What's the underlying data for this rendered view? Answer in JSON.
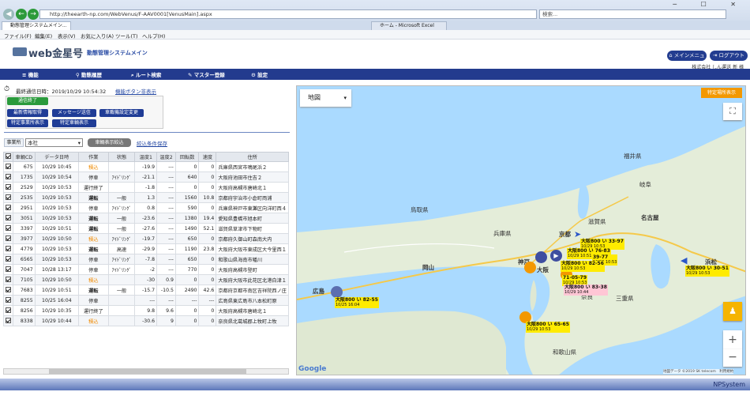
{
  "browser": {
    "address": "http://theearth-np.com/WebVenus/F-AAV0001[VenusMain].aspx",
    "search_placeholder": "検索...",
    "tab1": "動態管理システムメイン...",
    "tab2": "ホーム - Microsoft Excel"
  },
  "menu": [
    "ファイル(F)",
    "編集(E)",
    "表示(V)",
    "お気に入り(A)",
    "ツール(T)",
    "ヘルプ(H)"
  ],
  "header": {
    "logo": "web金星号",
    "subtitle": "動態管理システムメイン",
    "main_menu": "メインメニュー",
    "logout": "ログアウト",
    "company": "株式会社 しん運送 新 様"
  },
  "nav": [
    "機能",
    "動態履歴",
    "ルート検索",
    "マスター登録",
    "設定"
  ],
  "status": {
    "last_update": "最終通信日時：2019/10/29 10:54:32",
    "hide_buttons": "機能ボタン非表示"
  },
  "buttons": {
    "end_comm": "通信終了",
    "latest": "最新情報取得",
    "message": "メッセージ送信",
    "car_settings": "車載機設定変更",
    "spec_office": "特定事業所表示",
    "spec_vehicle": "特定車輌表示"
  },
  "filter": {
    "office_label": "事業所",
    "office_value": "本社",
    "filter_btn": "車輌表示絞込",
    "save": "絞込条件保存"
  },
  "table": {
    "headers": [
      "",
      "車輌CD",
      "データ日時",
      "作業",
      "状態",
      "温度1",
      "温度2",
      "回転数",
      "速度",
      "住所"
    ],
    "rows": [
      [
        "675",
        "10/29 10:45",
        "積込",
        "",
        "-19.9",
        "---",
        "0",
        "0",
        "兵庫県西宮市鳴尾浜２"
      ],
      [
        "1735",
        "10/29 10:54",
        "停車",
        "ｱｲﾄﾞﾘﾝｸﾞ",
        "-21.1",
        "---",
        "640",
        "0",
        "大阪府池田市住吉２"
      ],
      [
        "2529",
        "10/29 10:53",
        "運行終了",
        "",
        "-1.8",
        "---",
        "0",
        "0",
        "大阪府高槻市唐崎北１"
      ],
      [
        "2535",
        "10/29 10:53",
        "運転",
        "一般",
        "1.3",
        "---",
        "1560",
        "10.8",
        "京都府宇治市小倉町両浦"
      ],
      [
        "2951",
        "10/29 10:53",
        "停車",
        "ｱｲﾄﾞﾘﾝｸﾞ",
        "0.8",
        "---",
        "590",
        "0",
        "兵庫県神戸市東灘区向洋町西４"
      ],
      [
        "3051",
        "10/29 10:53",
        "運転",
        "一般",
        "-23.6",
        "---",
        "1380",
        "19.4",
        "愛知県豊橋市旭本町"
      ],
      [
        "3397",
        "10/29 10:51",
        "運転",
        "一般",
        "-27.6",
        "---",
        "1490",
        "52.1",
        "滋賀県草津市下物町"
      ],
      [
        "3977",
        "10/29 10:50",
        "積込",
        "ｱｲﾄﾞﾘﾝｸﾞ",
        "-19.7",
        "---",
        "650",
        "0",
        "京都府久御山町森南大内"
      ],
      [
        "4779",
        "10/29 10:53",
        "運転",
        "高速",
        "-29.9",
        "---",
        "1190",
        "23.8",
        "大阪府大阪市東成区大今里西１"
      ],
      [
        "6565",
        "10/29 10:53",
        "停車",
        "ｱｲﾄﾞﾘﾝｸﾞ",
        "-7.8",
        "---",
        "650",
        "0",
        "和歌山県海南市幡川"
      ],
      [
        "7047",
        "10/28 13:17",
        "停車",
        "ｱｲﾄﾞﾘﾝｸﾞ",
        "-2",
        "---",
        "770",
        "0",
        "大阪府高槻市登町"
      ],
      [
        "7105",
        "10/29 10:50",
        "積込",
        "",
        "-30",
        "0.9",
        "0",
        "0",
        "大阪府大阪市此花区北港白津１"
      ],
      [
        "7683",
        "10/29 10:51",
        "運転",
        "一般",
        "-15.7",
        "-10.5",
        "2490",
        "42.6",
        "京都府京都市南区吉祥院西ノ庄"
      ],
      [
        "8255",
        "10/25 16:04",
        "停車",
        "",
        "---",
        "---",
        "---",
        "---",
        "広島県東広島市八本松町原"
      ],
      [
        "8256",
        "10/29 10:35",
        "運行終了",
        "",
        "9.8",
        "9.6",
        "0",
        "0",
        "大阪府高槻市唐崎北１"
      ],
      [
        "8338",
        "10/29 10:44",
        "積込",
        "",
        "-30.6",
        "9",
        "0",
        "0",
        "奈良県北葛城郡上牧町上牧"
      ]
    ]
  },
  "map": {
    "type": "地図",
    "special_btn": "特定場所表示",
    "google": "Google",
    "attribution": "地図データ ©2019 SK telecom　利用規約",
    "cities": [
      "京都",
      "名古屋",
      "大阪",
      "神戸",
      "岡山",
      "広島",
      "浜松",
      "岐阜",
      "奈良",
      "三重県",
      "兵庫県",
      "鳥取県",
      "福井県",
      "滋賀県",
      "和歌山県"
    ],
    "labels": [
      {
        "t": "大阪800 い 33-97",
        "d": "10/29 10:53"
      },
      {
        "t": "大阪800 い 76-83",
        "d": "10/29 10:51"
      },
      {
        "t": "39-77",
        "d": "10/29 10:53"
      },
      {
        "t": "大阪800 い 82-56",
        "d": "10/29 10:53"
      },
      {
        "t": "71-05-79",
        "d": "10/29 10:53"
      },
      {
        "t": "大阪800 い 83-38",
        "d": "10/29 10:44"
      },
      {
        "t": "大阪800 い 82-55",
        "d": "10/25 16:04"
      },
      {
        "t": "大阪800 い 30-51",
        "d": "10/29 10:53"
      },
      {
        "t": "大阪800 い 65-65",
        "d": "10/29 10:53"
      }
    ]
  },
  "footer": "NPSystem"
}
